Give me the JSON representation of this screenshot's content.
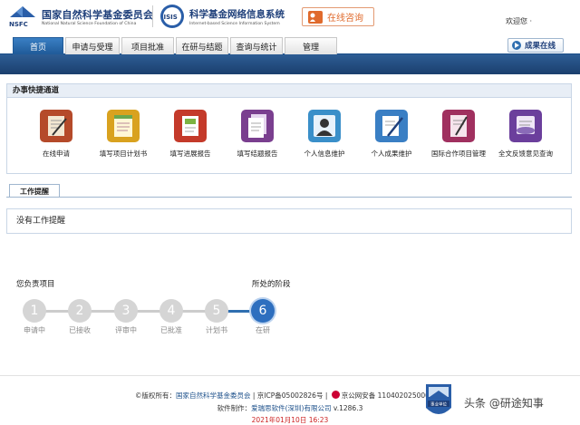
{
  "header": {
    "nsfc_title": "国家自然科学基金委员会",
    "nsfc_subtitle": "National Natural Science Foundation of China",
    "nsfc_logo_text": "NSFC",
    "isis_title": "科学基金网络信息系统",
    "isis_subtitle": "Internet-based Science Information System",
    "isis_logo_text": "ISIS",
    "online_consult_label": "在线咨询",
    "welcome_text": "欢迎您 ·"
  },
  "nav": {
    "tabs": [
      {
        "label": "首页",
        "active": true
      },
      {
        "label": "申请与受理",
        "active": false
      },
      {
        "label": "项目批准",
        "active": false
      },
      {
        "label": "在研与结题",
        "active": false
      },
      {
        "label": "查询与统计",
        "active": false
      },
      {
        "label": "管理",
        "active": false
      }
    ],
    "result_online_label": "成果在线"
  },
  "quick_access": {
    "title": "办事快捷通道",
    "items": [
      {
        "label": "在线申请",
        "icon": "pen-paper-icon",
        "color": "#b54a2a"
      },
      {
        "label": "填写项目计划书",
        "icon": "notepad-icon",
        "color": "#d9a21f"
      },
      {
        "label": "填写进展报告",
        "icon": "report-icon",
        "color": "#c43a2a"
      },
      {
        "label": "填写结题报告",
        "icon": "document-stack-icon",
        "color": "#7a3f8f"
      },
      {
        "label": "个人信息维护",
        "icon": "person-icon",
        "color": "#3a8fc9"
      },
      {
        "label": "个人成果维护",
        "icon": "pen-doc-icon",
        "color": "#3a7fc4"
      },
      {
        "label": "国际合作项目管理",
        "icon": "globe-doc-icon",
        "color": "#a0305f"
      },
      {
        "label": "全文反馈意见查询",
        "icon": "feedback-icon",
        "color": "#6b3f9c"
      }
    ]
  },
  "work_reminder": {
    "tab_label": "工作提醒",
    "message": "没有工作提醒"
  },
  "project_status": {
    "your_projects_label": "您负责项目",
    "current_stage_label": "所处的阶段",
    "current_step": 6,
    "steps": [
      {
        "num": "1",
        "label": "申请中"
      },
      {
        "num": "2",
        "label": "已接收"
      },
      {
        "num": "3",
        "label": "评审中"
      },
      {
        "num": "4",
        "label": "已批准"
      },
      {
        "num": "5",
        "label": "计划书"
      },
      {
        "num": "6",
        "label": "在研"
      }
    ]
  },
  "footer": {
    "copyright_prefix": "©版权所有：",
    "copyright_owner": "国家自然科学基金委员会",
    "icp": " | 京ICP备05002826号 | ",
    "police": "京公网安备 11040202500068号",
    "software_prefix": "软件制作：",
    "software_company": "爱瑞思软件(深圳)有限公司",
    "version": " v.1286.3",
    "date": "2021年01月10日 16:23",
    "badge_text": "事业单位"
  },
  "watermark": "头条 @研途知事"
}
